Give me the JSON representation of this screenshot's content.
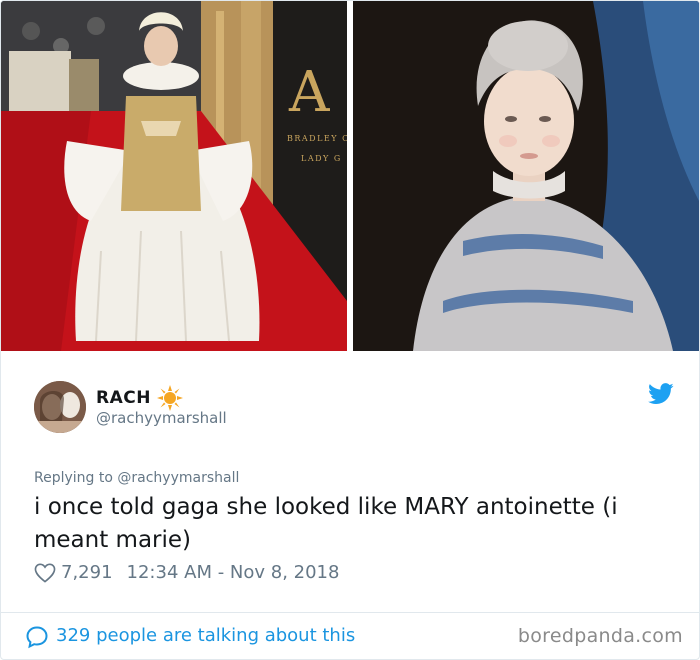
{
  "tweet": {
    "display_name": "RACH",
    "handle": "@rachyymarshall",
    "replying_to_prefix": "Replying to",
    "replying_to_handle": "@rachyymarshall",
    "text": "i once told gaga she looked like MARY antoinette (i meant marie)",
    "likes": "7,291",
    "timestamp": "12:34 AM - Nov 8, 2018",
    "talking_about": "329 people are talking about this"
  },
  "media": {
    "left_photo_sign_letter": "A",
    "left_photo_sign_line1": "BRADLEY CO",
    "left_photo_sign_line2": "LADY G"
  },
  "brand": "boredpanda.com",
  "icons": {
    "name_badge": "sun-icon",
    "platform": "twitter-bird-icon",
    "like": "heart-icon",
    "comments": "speech-bubble-icon"
  },
  "colors": {
    "accent": "#1da1f2",
    "link": "#1b95e0",
    "muted": "#657786",
    "sun": "#f5a623",
    "carpet": "#c4121a"
  }
}
